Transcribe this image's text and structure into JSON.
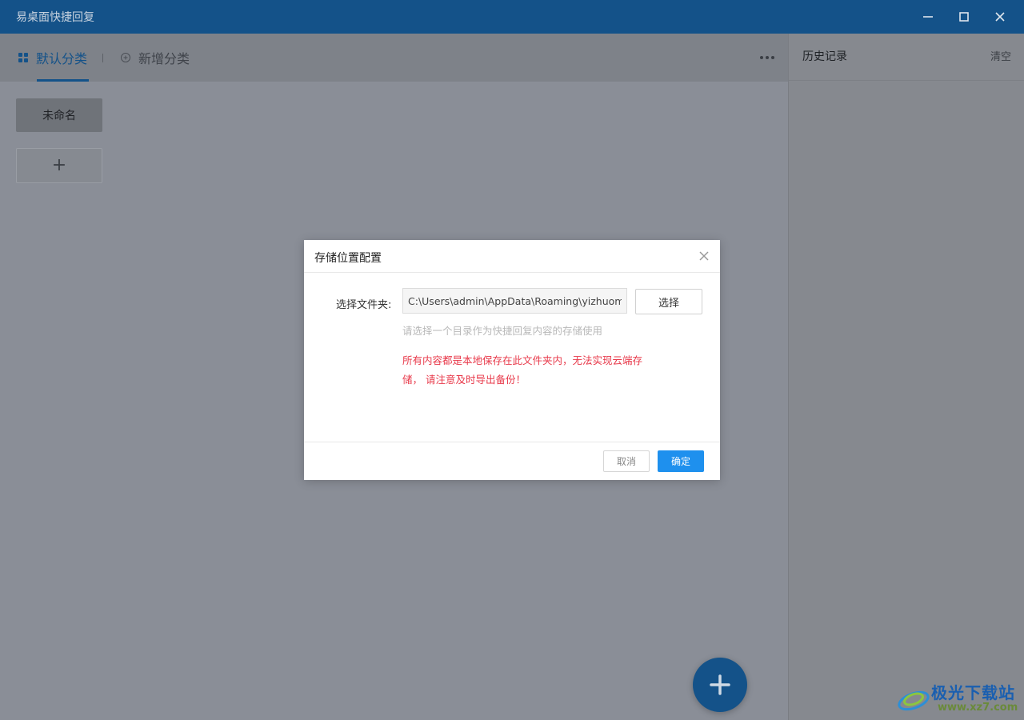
{
  "window": {
    "title": "易桌面快捷回复"
  },
  "tabs": {
    "default_label": "默认分类",
    "new_label": "新增分类"
  },
  "categories": [
    {
      "label": "未命名"
    }
  ],
  "add_category_label": "+",
  "history": {
    "title": "历史记录",
    "clear_label": "清空"
  },
  "dialog": {
    "title": "存储位置配置",
    "field_label": "选择文件夹:",
    "path_value": "C:\\Users\\admin\\AppData\\Roaming\\yizhuomian",
    "choose_label": "选择",
    "hint": "请选择一个目录作为快捷回复内容的存储使用",
    "warning_line1": "所有内容都是本地保存在此文件夹内，无法实现云端存",
    "warning_line2": "储， 请注意及时导出备份！",
    "cancel_label": "取消",
    "ok_label": "确定"
  },
  "watermark": {
    "name": "极光下载站",
    "url": "www.xz7.com"
  },
  "colors": {
    "titlebar": "#145289",
    "accent": "#1e90ee",
    "warning": "#e8394a"
  }
}
